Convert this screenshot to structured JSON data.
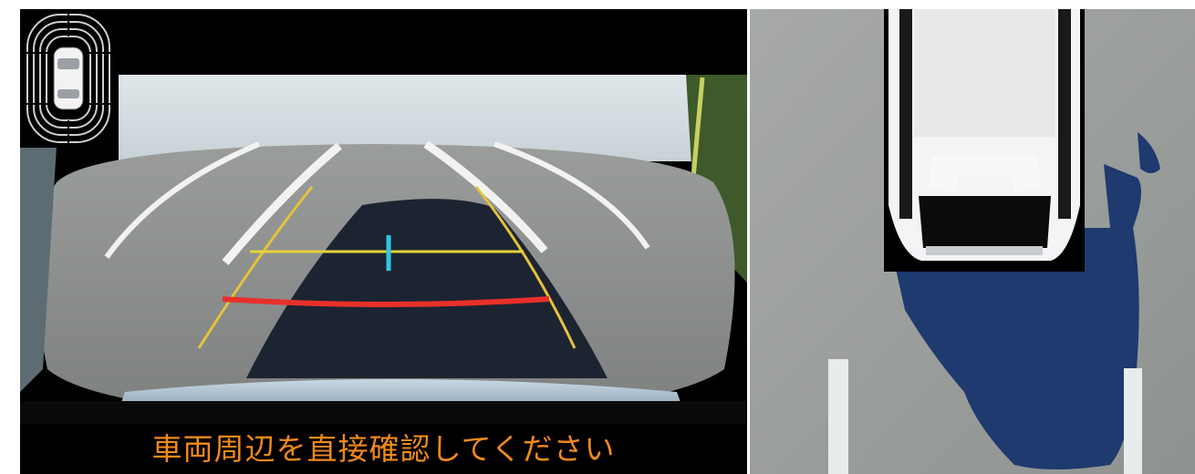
{
  "rear_camera_view": {
    "warning_text": "車両周辺を直接確認してください",
    "guide_line_colors": {
      "distance_near": "#e8302a",
      "distance_mid": "#e6d23a",
      "course_lines": "#e6c23a",
      "center_marker": "#2ec8e8"
    }
  },
  "minimap": {
    "icon": "car-top-view-icon",
    "sensor_ring_icon": "parking-sensor-arcs-icon"
  },
  "top_down_view": {
    "icon": "vehicle-overhead-icon",
    "shadow_color": "#1e3a6e"
  }
}
